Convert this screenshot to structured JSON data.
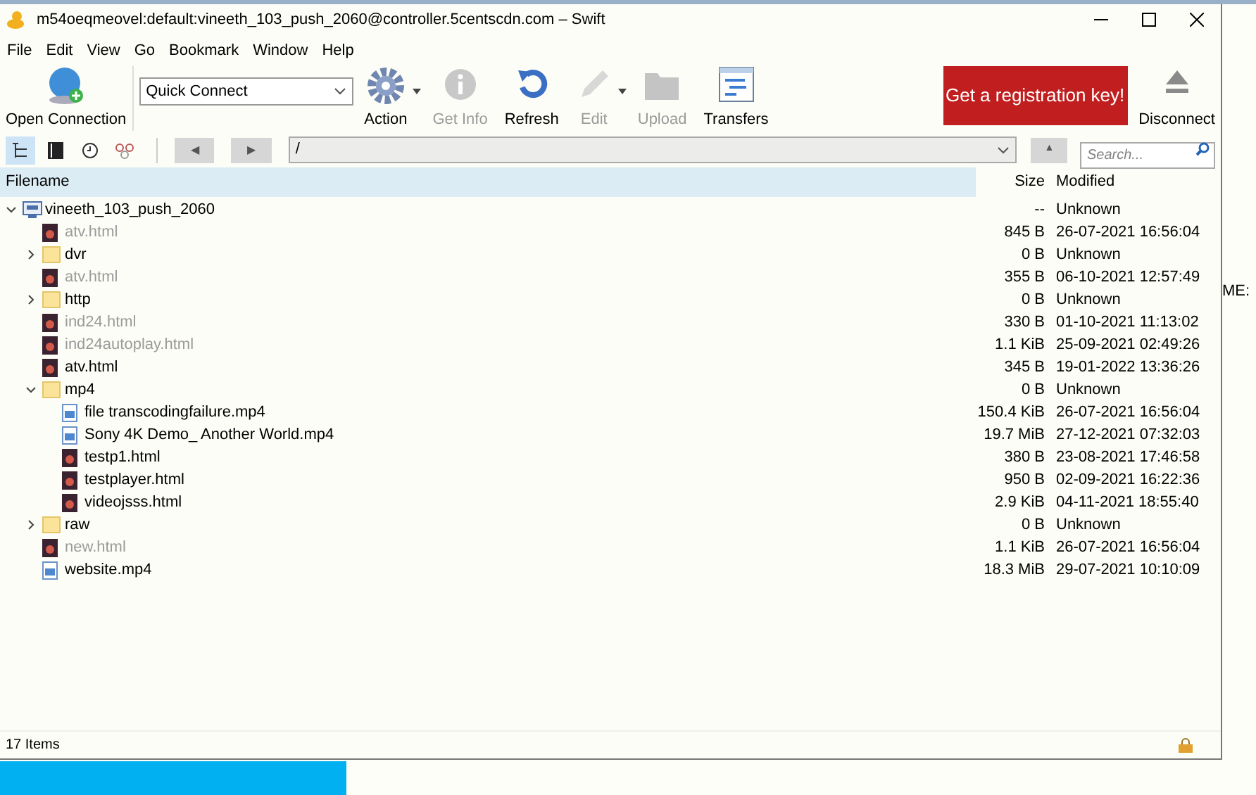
{
  "window": {
    "title": "m54oeqmeovel:default:vineeth_103_push_2060@controller.5centscdn.com – Swift"
  },
  "menu": [
    "File",
    "Edit",
    "View",
    "Go",
    "Bookmark",
    "Window",
    "Help"
  ],
  "toolbar": {
    "open_connection": "Open Connection",
    "quick_connect": "Quick Connect",
    "buttons": [
      {
        "label": "Action",
        "kind": "gear",
        "disabled": false,
        "dropdown": true
      },
      {
        "label": "Get Info",
        "kind": "info",
        "disabled": true,
        "dropdown": false
      },
      {
        "label": "Refresh",
        "kind": "refresh",
        "disabled": false,
        "dropdown": false
      },
      {
        "label": "Edit",
        "kind": "pencil",
        "disabled": true,
        "dropdown": true
      },
      {
        "label": "Upload",
        "kind": "upload",
        "disabled": true,
        "dropdown": false
      },
      {
        "label": "Transfers",
        "kind": "transfers",
        "disabled": false,
        "dropdown": false
      }
    ],
    "registration": "Get a registration key!",
    "disconnect": "Disconnect"
  },
  "navbar": {
    "views": [
      {
        "kind": "browser",
        "selected": true
      },
      {
        "kind": "bookmarks",
        "selected": false
      },
      {
        "kind": "history",
        "selected": false
      },
      {
        "kind": "bonjour",
        "selected": false
      }
    ],
    "back": "◀",
    "forward": "▶",
    "path": "/",
    "up": "▲",
    "search_placeholder": "Search..."
  },
  "table": {
    "columns": [
      "Filename",
      "Size",
      "Modified"
    ],
    "rows": [
      {
        "name": "vineeth_103_push_2060",
        "kind": "server",
        "size": "--",
        "modified": "Unknown",
        "blurred": false,
        "expanded": true,
        "children": [
          {
            "name": "atv.html",
            "kind": "html",
            "size": "845 B",
            "modified": "26-07-2021 16:56:04",
            "blurred": true
          },
          {
            "name": "dvr",
            "kind": "folder",
            "size": "0 B",
            "modified": "Unknown",
            "blurred": false,
            "expanded": false
          },
          {
            "name": "atv.html",
            "kind": "html",
            "size": "355 B",
            "modified": "06-10-2021 12:57:49",
            "blurred": true
          },
          {
            "name": "http",
            "kind": "folder",
            "size": "0 B",
            "modified": "Unknown",
            "blurred": false,
            "expanded": false
          },
          {
            "name": "ind24.html",
            "kind": "html",
            "size": "330 B",
            "modified": "01-10-2021 11:13:02",
            "blurred": true
          },
          {
            "name": "ind24autoplay.html",
            "kind": "html",
            "size": "1.1 KiB",
            "modified": "25-09-2021 02:49:26",
            "blurred": true
          },
          {
            "name": "atv.html",
            "kind": "html",
            "size": "345 B",
            "modified": "19-01-2022 13:36:26",
            "blurred": false
          },
          {
            "name": "mp4",
            "kind": "folder",
            "size": "0 B",
            "modified": "Unknown",
            "blurred": false,
            "expanded": true,
            "children": [
              {
                "name": "file transcodingfailure.mp4",
                "kind": "mp4",
                "size": "150.4 KiB",
                "modified": "26-07-2021 16:56:04",
                "blurred": false
              },
              {
                "name": "Sony 4K Demo_ Another World.mp4",
                "kind": "mp4",
                "size": "19.7 MiB",
                "modified": "27-12-2021 07:32:03",
                "blurred": false
              },
              {
                "name": "testp1.html",
                "kind": "html",
                "size": "380 B",
                "modified": "23-08-2021 17:46:58",
                "blurred": false
              },
              {
                "name": "testplayer.html",
                "kind": "html",
                "size": "950 B",
                "modified": "02-09-2021 16:22:36",
                "blurred": false
              },
              {
                "name": "videojsss.html",
                "kind": "html",
                "size": "2.9 KiB",
                "modified": "04-11-2021 18:55:40",
                "blurred": false
              }
            ]
          },
          {
            "name": "raw",
            "kind": "folder",
            "size": "0 B",
            "modified": "Unknown",
            "blurred": false,
            "expanded": false
          },
          {
            "name": "new.html",
            "kind": "html",
            "size": "1.1 KiB",
            "modified": "26-07-2021 16:56:04",
            "blurred": true
          },
          {
            "name": "website.mp4",
            "kind": "mp4",
            "size": "18.3 MiB",
            "modified": "29-07-2021 10:10:09",
            "blurred": false
          }
        ]
      }
    ]
  },
  "status_bar": {
    "text": "17 Items"
  },
  "desktop": {
    "text": "ME:"
  }
}
